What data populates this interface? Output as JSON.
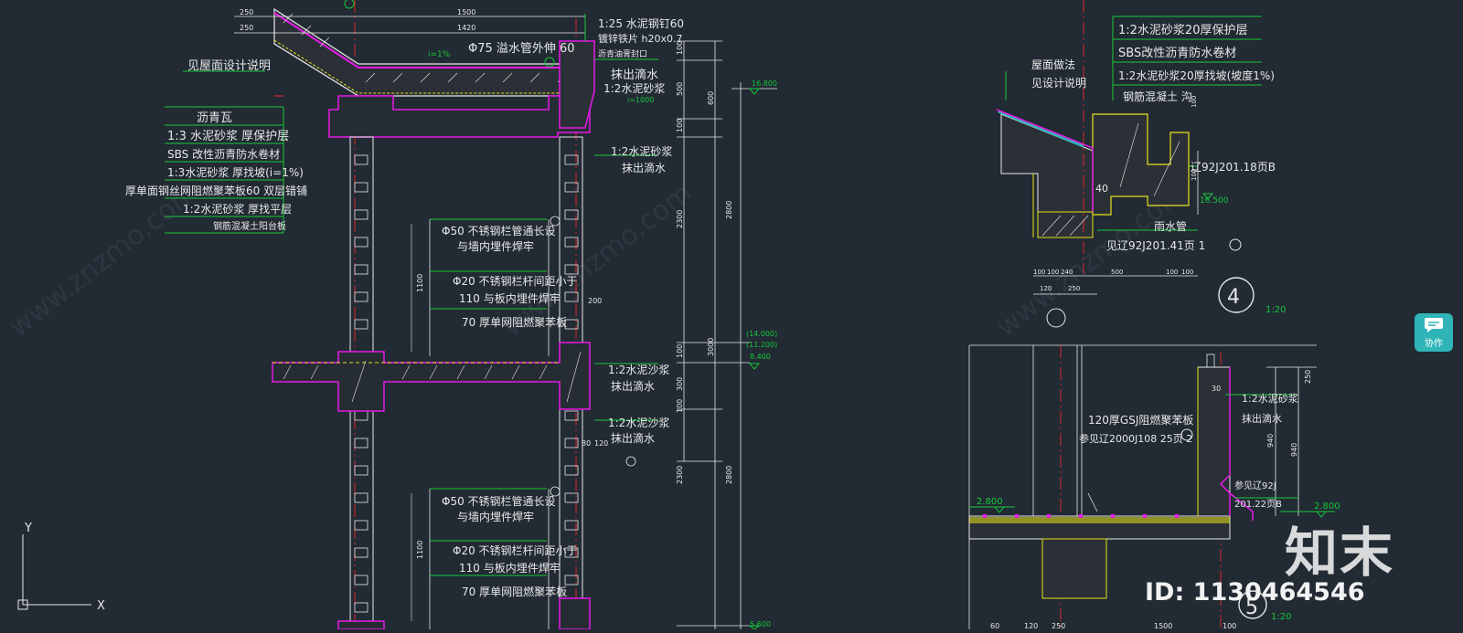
{
  "section_left": {
    "roof_note": "见屋面设计说明",
    "roof_slope": "i=1%",
    "downpipe_note": "Φ75 溢水管外伸 60",
    "gutter_note_1": "1:25 水泥钢钉60",
    "gutter_note_2": "镀锌铁片 h20x0.7",
    "gutter_note_3": "沥青油膏封口",
    "drip_1a": "抹出滴水",
    "drip_1b": "1:2水泥砂浆",
    "drip_1c": "i=1000",
    "drip_2a": "1:2水泥砂浆",
    "drip_2b": "抹出滴水",
    "layers": [
      "沥青瓦",
      "1:3 水泥砂浆 厚保护层",
      "SBS 改性沥青防水卷材",
      "1:3水泥砂浆 厚找坡(i=1%)",
      "厚单面钢丝网阻燃聚苯板60 双层错铺",
      "1:2水泥砂浆 厚找平层",
      "钢筋混凝土阳台板"
    ],
    "rail_a1": "Φ50 不锈钢栏管通长设",
    "rail_a2": "与墙内埋件焊牢",
    "rail_b1": "Φ20 不锈钢栏杆间距小于",
    "rail_b2": "110 与板内埋件焊牢",
    "rail_c": "70 厚单网阻燃聚苯板",
    "drip_3a": "1:2水泥沙浆",
    "drip_3b": "抹出滴水",
    "drip_4a": "1:2水泥沙浆",
    "drip_4b": "抹出滴水",
    "rail_d1": "Φ50 不锈钢栏管通长设",
    "rail_d2": "与墙内埋件焊牢",
    "rail_e1": "Φ20 不锈钢栏杆间距小于",
    "rail_e2": "110 与板内埋件焊牢",
    "rail_f": "70 厚单网阻燃聚苯板",
    "dims_top": [
      "250",
      "1500",
      "250",
      "1420"
    ],
    "dims_side": [
      "100",
      "500",
      "100",
      "600",
      "2300",
      "2800",
      "3000",
      "100",
      "300",
      "100",
      "2300",
      "2800",
      "1100",
      "1100",
      "200",
      "80",
      "120"
    ],
    "elev": [
      "16.800",
      "(14.000)",
      "(11.200)",
      "8.400",
      "5.600"
    ]
  },
  "detail4": {
    "layers": [
      "1:2水泥砂浆20厚保护层",
      "SBS改性沥青防水卷材",
      "1:2水泥砂浆20厚找坡(坡度1%)",
      "钢筋混凝土 沟"
    ],
    "roof_note_1": "屋面做法",
    "roof_note_2": "见设计说明",
    "ref_1": "辽92J201.18页B",
    "downpipe": "雨水管",
    "ref_2": "见辽92J201.41页 1",
    "num_40": "40",
    "elev": "16.500",
    "dims": [
      "100",
      "100",
      "500",
      "100",
      "100",
      "120",
      "250",
      "240",
      "100",
      "100"
    ],
    "circle": "4",
    "scale": "1:20"
  },
  "detail5": {
    "panel_1": "120厚GSJ阻燃聚苯板",
    "panel_2": "参见辽2000J108 25页 2",
    "drip_1": "1:2水泥砂浆",
    "drip_2": "抹出滴水",
    "ref_1": "参见辽92J",
    "ref_2": "201.22页B",
    "elev_left": "2.800",
    "elev_right": "2.800",
    "dims": [
      "940",
      "940",
      "250",
      "30",
      "60",
      "120",
      "250",
      "1500",
      "100"
    ],
    "circle": "5",
    "scale": "1:20"
  },
  "ucs": {
    "y": "Y",
    "x": "X"
  },
  "side_button": {
    "label": "协作",
    "icon": "chat-bubble-icon"
  },
  "watermark": {
    "logo": "知末",
    "id": "ID: 1130464546",
    "url": "www.znzmo.com"
  },
  "colors": {
    "bg": "#222a33",
    "white": "#e8e8e8",
    "green": "#15c93a",
    "yellow": "#e6e21a",
    "magenta": "#e619e6",
    "red": "#d9262b",
    "accent": "#2fb4b8"
  }
}
